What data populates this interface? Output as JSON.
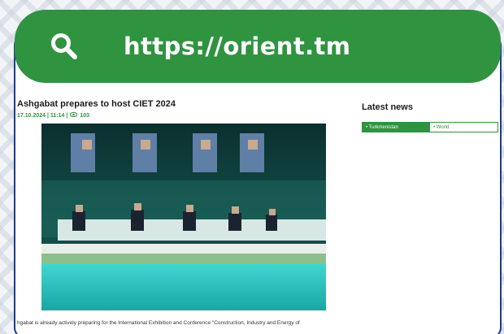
{
  "address_bar": {
    "url": "https://orient.tm",
    "icon": "search-icon"
  },
  "article": {
    "title": "Ashgabat prepares to host CIET 2024",
    "date": "17.10.2024 | 11:14 |",
    "views": "103",
    "excerpt": "hgabat is already actively preparing for the International Exhibition and Conference \"Construction, Industry and Energy of"
  },
  "sidebar": {
    "title": "Latest news",
    "tabs": [
      {
        "label": "• Turkmenistan",
        "active": true
      },
      {
        "label": "• World",
        "active": false
      }
    ]
  },
  "colors": {
    "brand_green": "#2f9340",
    "frame_border": "#1d3d8f"
  }
}
